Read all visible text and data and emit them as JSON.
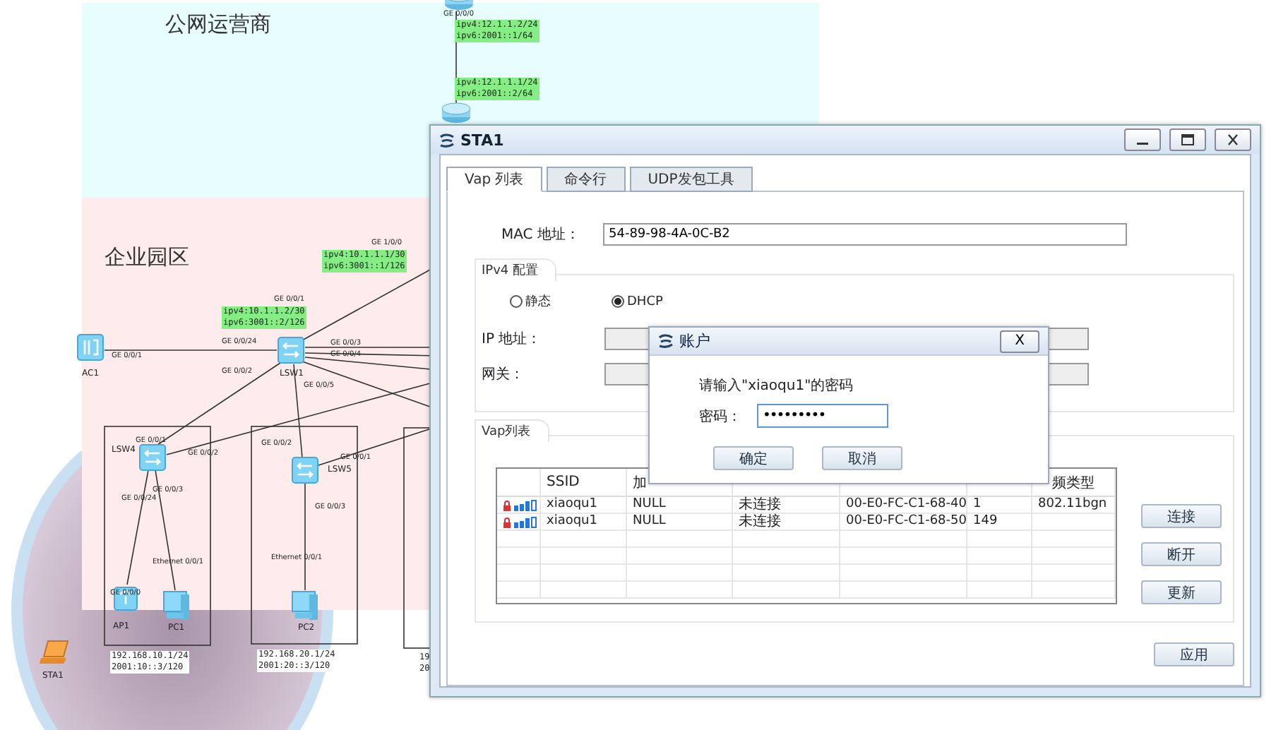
{
  "topology": {
    "zones": [
      {
        "label": "公网运营商"
      },
      {
        "label": "企业园区"
      }
    ],
    "devices": [
      {
        "kind": "router"
      },
      {
        "kind": "router"
      },
      {
        "kind": "ac",
        "label": "AC1"
      },
      {
        "kind": "switch",
        "label": "LSW1"
      },
      {
        "kind": "switch",
        "label": "LSW4"
      },
      {
        "kind": "switch",
        "label": "LSW5"
      },
      {
        "kind": "ap",
        "label": "AP1"
      },
      {
        "kind": "pc",
        "label": "PC1"
      },
      {
        "kind": "pc",
        "label": "PC2"
      },
      {
        "kind": "laptop",
        "label": "STA1"
      }
    ],
    "port_labels": [
      "GE 0/0/0",
      "GE 1/0/0",
      "GE 0/0/1",
      "GE 0/0/24",
      "GE 0/0/1",
      "GE 0/0/3",
      "GE 0/0/4",
      "GE 0/0/2",
      "GE 0/0/5",
      "GE 0/0/1",
      "GE 0/0/2",
      "GE 0/0/3",
      "GE 0/0/24",
      "Ethernet 0/0/1",
      "GE 0/0/0",
      "GE 0/0/2",
      "GE 0/0/1",
      "GE 0/0/3",
      "Ethernet 0/0/1"
    ],
    "address_tags": [
      {
        "lines": [
          "ipv4:12.1.1.2/24",
          "ipv6:2001::1/64"
        ]
      },
      {
        "lines": [
          "ipv4:12.1.1.1/24",
          "ipv6:2001::2/64"
        ]
      },
      {
        "lines": [
          "ipv4:10.1.1.1/30",
          "ipv6:3001::1/126"
        ]
      },
      {
        "lines": [
          "ipv4:10.1.1.2/30",
          "ipv6:3001::2/126"
        ]
      }
    ],
    "subnet_notes": [
      {
        "lines": [
          "192.168.10.1/24",
          "2001:10::3/120"
        ]
      },
      {
        "lines": [
          "192.168.20.1/24",
          "2001:20::3/120"
        ]
      },
      {
        "lines": [
          "19",
          "20"
        ]
      }
    ]
  },
  "window": {
    "title": "STA1",
    "tabs": [
      {
        "label": "Vap 列表",
        "selected": true
      },
      {
        "label": "命令行",
        "selected": false
      },
      {
        "label": "UDP发包工具",
        "selected": false
      }
    ],
    "mac": {
      "label": "MAC 地址：",
      "value": "54-89-98-4A-0C-B2"
    },
    "ipv4": {
      "title": "IPv4 配置",
      "modes": [
        {
          "label": "静态",
          "selected": false
        },
        {
          "label": "DHCP",
          "selected": true
        }
      ],
      "ip_label": "IP 地址：",
      "gateway_label": "网关："
    },
    "vap": {
      "title": "Vap列表",
      "columns": [
        "SSID",
        "加",
        "频类型"
      ],
      "rows": [
        {
          "ssid": "xiaoqu1",
          "encryption": "NULL",
          "status": "未连接",
          "mac": "00-E0-FC-C1-68-40",
          "channel": "1",
          "radio_type": "802.11bgn"
        },
        {
          "ssid": "xiaoqu1",
          "encryption": "NULL",
          "status": "未连接",
          "mac": "00-E0-FC-C1-68-50",
          "channel": "149"
        }
      ],
      "buttons": [
        "连接",
        "断开",
        "更新"
      ]
    },
    "apply_button": "应用"
  },
  "dialog": {
    "title": "账户",
    "close": "X",
    "prompt": "请输入\"xiaoqu1\"的密码",
    "password_label": "密码：",
    "password_value": "•••••••••",
    "buttons": [
      "确定",
      "取消"
    ]
  }
}
